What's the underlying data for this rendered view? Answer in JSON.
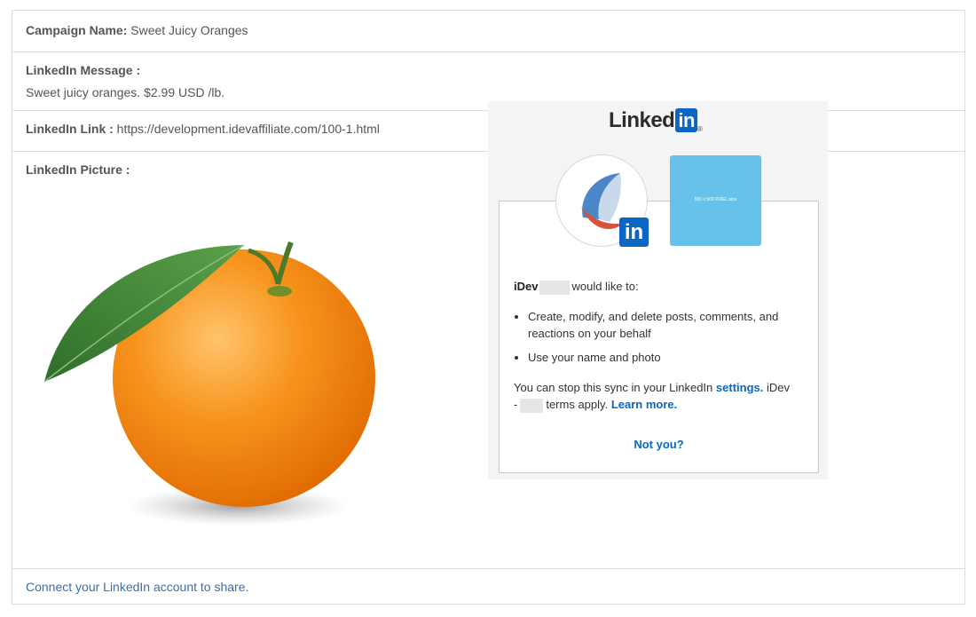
{
  "campaign": {
    "name_label": "Campaign Name:",
    "name_value": "Sweet Juicy Oranges",
    "message_label": "LinkedIn Message :",
    "message_value": "Sweet juicy oranges. $2.99 USD /lb.",
    "link_label": "LinkedIn Link :",
    "link_value": "https://development.idevaffiliate.com/100-1.html",
    "picture_label": "LinkedIn Picture :",
    "connect_link": "Connect your LinkedIn account to share."
  },
  "linkedin_popup": {
    "logo_text": "Linked",
    "logo_in": "in",
    "logo_reg": "®",
    "badge_text": "in",
    "placeholder_text": "500 x 500 PIXEL size",
    "app_name": "iDev",
    "intro_suffix": "would like to:",
    "permissions": [
      "Create, modify, and delete posts, comments, and reactions on your behalf",
      "Use your name and photo"
    ],
    "footnote_part1": "You can stop this sync in your LinkedIn",
    "footnote_settings": "settings.",
    "footnote_part2": "iDev",
    "footnote_dash": "-",
    "footnote_part3": "terms apply.",
    "footnote_learn": "Learn more.",
    "not_you": "Not you?"
  },
  "colors": {
    "linkedin_blue": "#0a66c2",
    "link_color": "#3b6ea5",
    "placeholder_blue": "#66c2ea",
    "orange": "#f7941d"
  },
  "icons": [
    "linkedin-logo-icon",
    "app-logo-icon",
    "linkedin-badge-icon"
  ]
}
